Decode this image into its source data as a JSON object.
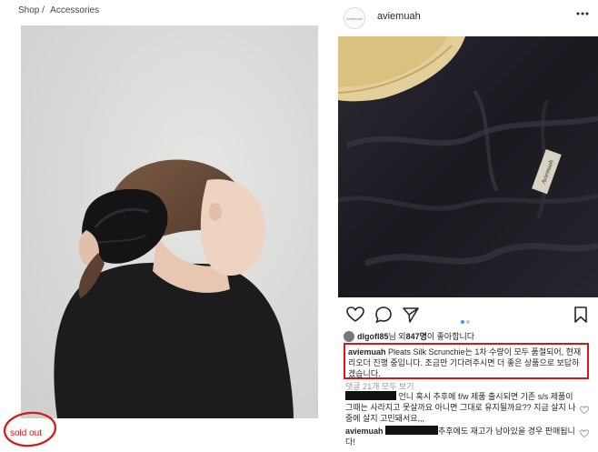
{
  "shop": {
    "breadcrumb": [
      {
        "label": "Shop"
      },
      {
        "label": "Accessories"
      }
    ],
    "breadcrumb_separator": "/",
    "sold_out_label": "sold out",
    "sold_out_color": "#d21818"
  },
  "instagram": {
    "avatar_text": "Aviemuah",
    "username": "aviemuah",
    "label_tag_text": "Aviemuah",
    "likes": {
      "user": "dlgofl85",
      "mid": "님 외 ",
      "count": "847명",
      "tail": "이 좋아합니다"
    },
    "caption": {
      "user": "aviemuah",
      "text": " Pleats Silk Scrunchie는 1차 수량이 모두 품절되어, 현재 리오더 진행 중입니다. 조금만 기다려주시면 더 좋은 상품으로 보답하겠습니다."
    },
    "view_comments": "댓글 21개 모두 보기",
    "comments": [
      {
        "user": "",
        "text": " 언니 혹시 추후에 f/w 제품 출시되면 기존 s/s 제품이 그때는 사라지고 못살까요 아니면 그대로 유지될까요?? 지금 살지 나중에 살지 고민돼서요,,,"
      },
      {
        "user": "aviemuah",
        "text": "추후에도 재고가 남아있을 경우 판매됩니다!"
      }
    ],
    "carousel": {
      "total": 2,
      "active": 0
    },
    "highlight_color": "#d21818",
    "accent_color": "#3897f0"
  }
}
